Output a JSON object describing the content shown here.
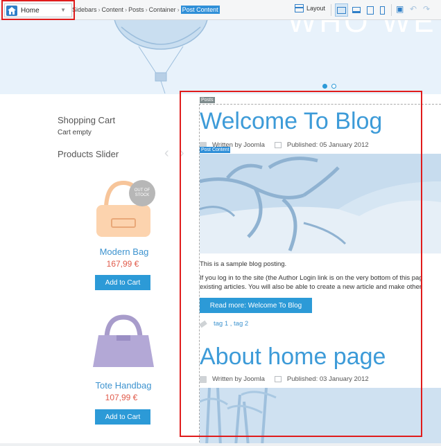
{
  "toolbar": {
    "page_select": "Home",
    "breadcrumb": [
      "Sidebars",
      "Content",
      "Posts",
      "Container"
    ],
    "breadcrumb_current": "Post Content",
    "layout_label": "Layout"
  },
  "sidebar": {
    "cart_heading": "Shopping Cart",
    "cart_status": "Cart empty",
    "slider_heading": "Products Slider",
    "products": [
      {
        "name": "Modern Bag",
        "price": "167,99 €",
        "badge": "OUT OF STOCK",
        "button": "Add to Cart"
      },
      {
        "name": "Tote Handbag",
        "price": "107,99 €",
        "button": "Add to Cart"
      }
    ]
  },
  "main": {
    "posts_label": "Posts",
    "post_content_label": "Post Content",
    "posts": [
      {
        "title": "Welcome To Blog",
        "author": "Written by Joomla",
        "published": "Published: 05 January 2012",
        "text1": "This is a sample blog posting.",
        "text2a": "If you log in to the site (the Author Login link is on the very bottom of this pag",
        "text2b": "existing articles. You will also be able to create a new article and make other",
        "read_more": "Read more: Welcome To Blog",
        "tags": "tag 1 , tag 2"
      },
      {
        "title": "About home page",
        "author": "Written by Joomla",
        "published": "Published: 03 January 2012"
      }
    ]
  },
  "colors": {
    "accent": "#2c9ad7",
    "title_blue": "#3d9bd8",
    "price_red": "#e05a4a",
    "highlight_red": "#e01b1b"
  }
}
